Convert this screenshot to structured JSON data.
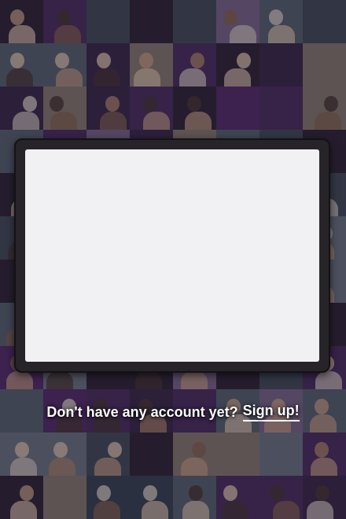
{
  "background": {
    "tile_palette": [
      "#4d2f63",
      "#5a6674",
      "#3b2a4c",
      "#6f7a86",
      "#2f2838",
      "#7c6a8e",
      "#45505c",
      "#8b7f75",
      "#562e6e",
      "#384654"
    ],
    "figure_palette": [
      "#c9a48a",
      "#8a6a55",
      "#e0c9b4",
      "#4a3a35",
      "#b08a6e",
      "#d8d0c8"
    ]
  },
  "signup_prompt": {
    "text": "Don't have any account yet?",
    "link_label": "Sign up!"
  }
}
